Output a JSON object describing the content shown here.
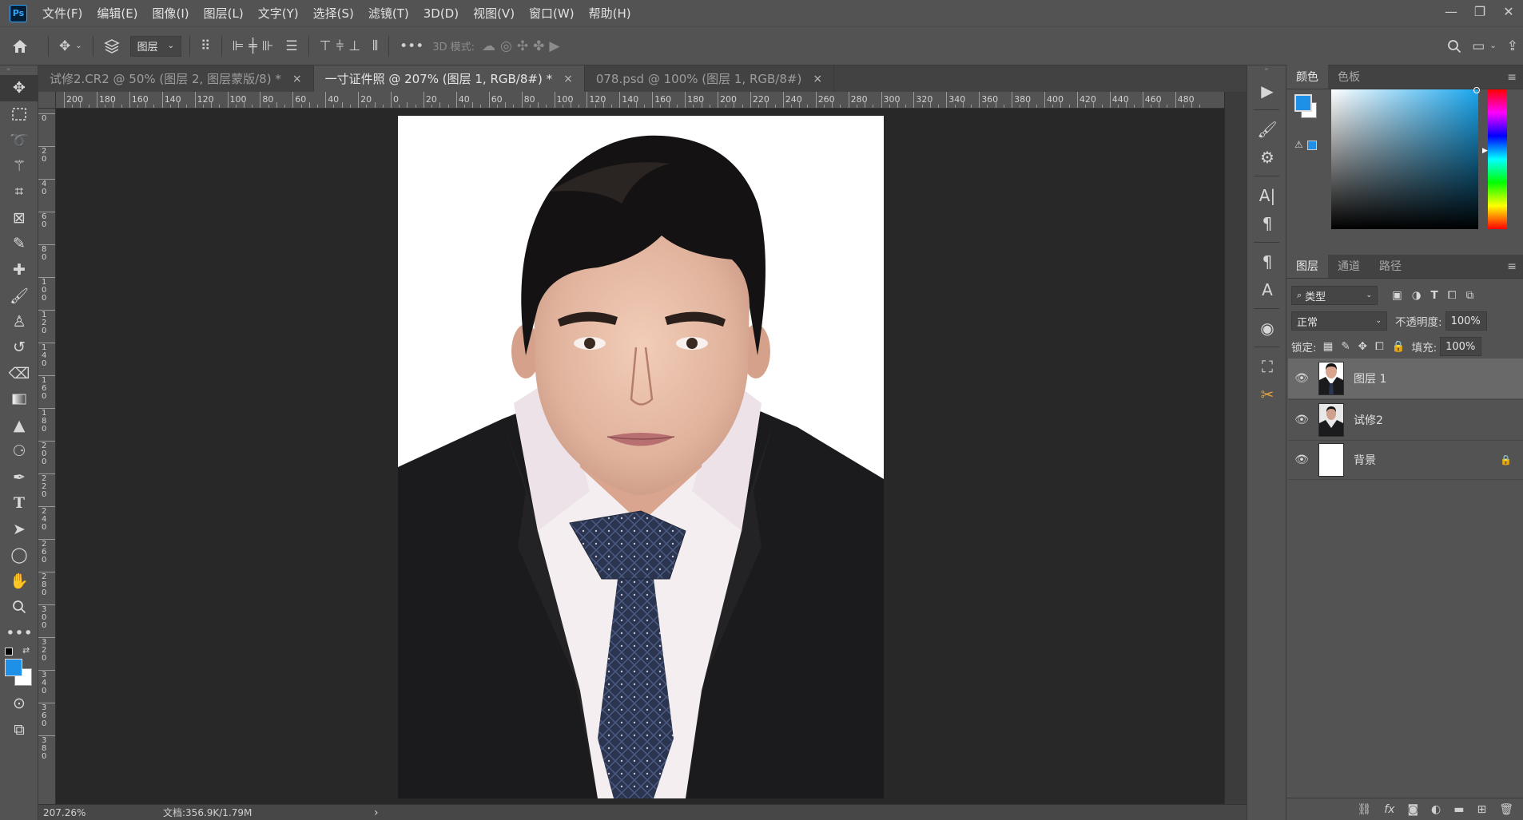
{
  "app": {
    "logo": "Ps"
  },
  "menu": [
    "文件(F)",
    "编辑(E)",
    "图像(I)",
    "图层(L)",
    "文字(Y)",
    "选择(S)",
    "滤镜(T)",
    "3D(D)",
    "视图(V)",
    "窗口(W)",
    "帮助(H)"
  ],
  "options": {
    "layer_select": "图层",
    "mode_3d": "3D 模式:"
  },
  "tabs": [
    {
      "label": "试修2.CR2 @ 50% (图层 2, 图层蒙版/8) *",
      "close": "×",
      "active": false
    },
    {
      "label": "一寸证件照 @ 207% (图层 1, RGB/8#) *",
      "close": "×",
      "active": true
    },
    {
      "label": "078.psd @ 100% (图层 1, RGB/8#)",
      "close": "×",
      "active": false
    }
  ],
  "ruler_h": [
    "200",
    "180",
    "160",
    "140",
    "120",
    "100",
    "80",
    "60",
    "40",
    "20",
    "0",
    "20",
    "40",
    "60",
    "80",
    "100",
    "120",
    "140",
    "160",
    "180",
    "200",
    "220",
    "240",
    "260",
    "280",
    "300",
    "320",
    "340",
    "360",
    "380",
    "400",
    "420",
    "440",
    "460",
    "480"
  ],
  "ruler_v": [
    "0",
    "2 0",
    "4 0",
    "6 0",
    "8 0",
    "1 0 0",
    "1 2 0",
    "1 4 0",
    "1 6 0",
    "1 8 0",
    "2 0 0",
    "2 2 0",
    "2 4 0",
    "2 6 0",
    "2 8 0",
    "3 0 0",
    "3 2 0",
    "3 4 0",
    "3 6 0",
    "3 8 0"
  ],
  "status": {
    "zoom": "207.26%",
    "doc": "文档:356.9K/1.79M",
    "arrow": "›"
  },
  "color_panel": {
    "tabs": [
      "颜色",
      "色板"
    ],
    "fg": "#1e90e8",
    "bg": "#ffffff"
  },
  "layers_panel": {
    "tabs": [
      "图层",
      "通道",
      "路径"
    ],
    "filter_label": "类型",
    "blend_mode": "正常",
    "opacity_label": "不透明度:",
    "opacity": "100%",
    "lock_label": "锁定:",
    "fill_label": "填充:",
    "fill": "100%",
    "layers": [
      {
        "name": "图层 1",
        "selected": true,
        "locked": false
      },
      {
        "name": "试修2",
        "selected": false,
        "locked": false
      },
      {
        "name": "背景",
        "selected": false,
        "locked": true
      }
    ]
  },
  "colors": {
    "accent": "#31a8ff",
    "panel": "#535353",
    "canvas_bg": "#282828"
  }
}
